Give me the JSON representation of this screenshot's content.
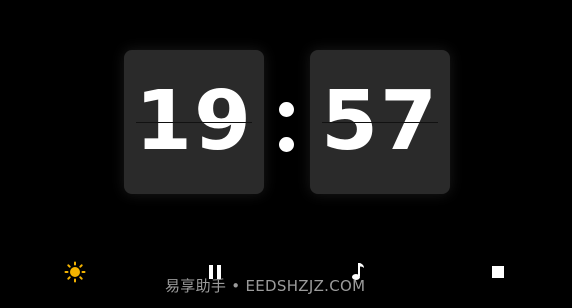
{
  "clock": {
    "hours": "19",
    "separator": ":",
    "minutes": "57"
  },
  "toolbar": {
    "icons": [
      "sun-icon",
      "pause-icon",
      "music-note-icon",
      "stop-icon"
    ],
    "brightness_color": "#f5b400",
    "icon_color": "#ffffff"
  },
  "watermark": {
    "text": "易享助手 • EEDSHZJZ.COM"
  },
  "colors": {
    "background": "#000000",
    "card": "#2a2a2a",
    "digit": "#ffffff"
  }
}
